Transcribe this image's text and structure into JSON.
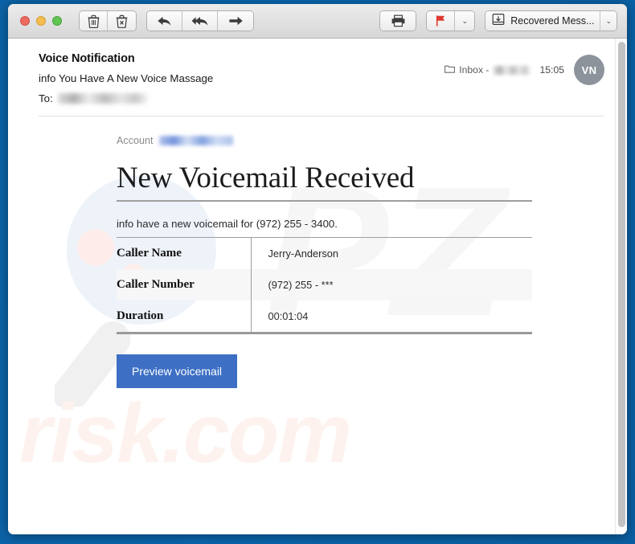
{
  "window": {
    "traffic_lights": [
      "close",
      "minimize",
      "zoom"
    ]
  },
  "toolbar": {
    "delete_icon": "trash-icon",
    "junk_icon": "junk-trash-icon",
    "reply_icon": "reply-arrow-icon",
    "reply_all_icon": "reply-all-arrow-icon",
    "forward_icon": "forward-arrow-icon",
    "print_icon": "printer-icon",
    "flag_icon": "red-flag-icon",
    "flag_chevron": "⌄",
    "mailbox_icon": "move-to-mailbox-icon",
    "mailbox_label": "Recovered Mess...",
    "mailbox_chevron": "⌄"
  },
  "header": {
    "subject": "Voice Notification",
    "sender": "info You Have A New Voice Massage",
    "to_label": "To:",
    "to_value_redacted": true,
    "mailbox_icon": "folder-icon",
    "mailbox_text": "Inbox -",
    "mailbox_value_redacted": true,
    "time": "15:05",
    "avatar_initials": "VN"
  },
  "body": {
    "account_label": "Account",
    "account_value_redacted": true,
    "title": "New Voicemail Received",
    "intro": "info have a new voicemail for (972) 255 - 3400.",
    "table": {
      "rows": [
        {
          "label": "Caller Name",
          "value": "Jerry-Anderson"
        },
        {
          "label": "Caller Number",
          "value": "(972) 255 - ***"
        },
        {
          "label": "Duration",
          "value": "00:01:04"
        }
      ]
    },
    "cta_label": "Preview voicemail"
  },
  "watermark": {
    "big_text": "PZ",
    "bottom_text": "risk.com"
  },
  "colors": {
    "desktop": "#0a63a8",
    "cta_blue": "#3d6fc4",
    "avatar_gray": "#8d939b",
    "flag_red": "#e03a2f",
    "watermark_pink": "#fdf2ee"
  },
  "scrollbar": {
    "orientation": "vertical",
    "position": "right"
  }
}
